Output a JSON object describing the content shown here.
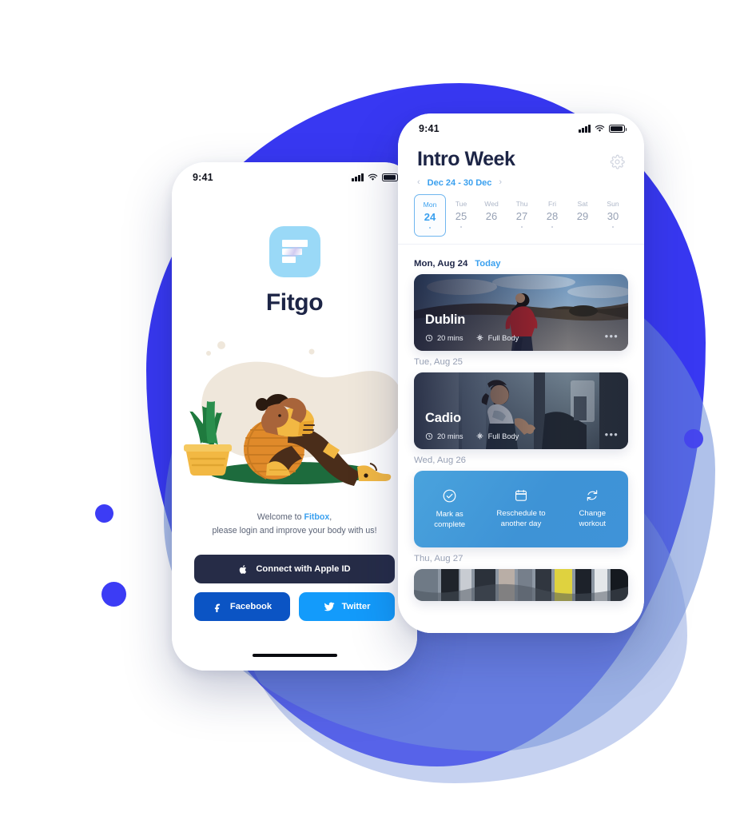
{
  "left_phone": {
    "status_bar": {
      "time": "9:41",
      "signal_icon": "cellular-signal-icon",
      "wifi_icon": "wifi-icon",
      "battery_icon": "battery-icon"
    },
    "logo": {
      "icon": "fitgo-logo-icon",
      "brand": "Fitgo"
    },
    "illustration": "woman-exercising-on-ball-illustration",
    "welcome": {
      "line1_pre": "Welcome to ",
      "line1_brand": "Fitbox",
      "line1_post": ",",
      "line2": "please login and improve your body with us!"
    },
    "buttons": {
      "apple": {
        "label": "Connect with Apple ID",
        "icon": "apple-icon",
        "color": "#262c47"
      },
      "facebook": {
        "label": "Facebook",
        "icon": "facebook-icon",
        "color": "#0b54c4"
      },
      "twitter": {
        "label": "Twitter",
        "icon": "twitter-icon",
        "color": "#139bfb"
      }
    },
    "home_indicator": "home-indicator"
  },
  "right_phone": {
    "status_bar": {
      "time": "9:41",
      "signal_icon": "cellular-signal-icon",
      "wifi_icon": "wifi-icon",
      "battery_icon": "battery-icon"
    },
    "title": "Intro Week",
    "settings_icon": "gear-icon",
    "week_nav": {
      "prev": "‹",
      "range": "Dec 24 - 30 Dec",
      "next": "›"
    },
    "days": [
      {
        "name": "Mon",
        "num": "24",
        "selected": true,
        "has_dot": true
      },
      {
        "name": "Tue",
        "num": "25",
        "selected": false,
        "has_dot": true
      },
      {
        "name": "Wed",
        "num": "26",
        "selected": false,
        "has_dot": false
      },
      {
        "name": "Thu",
        "num": "27",
        "selected": false,
        "has_dot": true
      },
      {
        "name": "Fri",
        "num": "28",
        "selected": false,
        "has_dot": true
      },
      {
        "name": "Sat",
        "num": "29",
        "selected": false,
        "has_dot": false
      },
      {
        "name": "Sun",
        "num": "30",
        "selected": false,
        "has_dot": true
      }
    ],
    "feed": [
      {
        "date_label": "Mon, Aug 24",
        "today_label": "Today",
        "is_today": true,
        "card": {
          "kind": "workout",
          "title": "Dublin",
          "duration": "20 mins",
          "focus": "Full Body",
          "duration_icon": "clock-icon",
          "focus_icon": "body-target-icon",
          "more_icon": "ellipsis-icon",
          "photo": "woman-running-on-road-photo"
        }
      },
      {
        "date_label": "Tue, Aug 25",
        "is_today": false,
        "card": {
          "kind": "workout",
          "title": "Cadio",
          "duration": "20 mins",
          "focus": "Full Body",
          "duration_icon": "clock-icon",
          "focus_icon": "body-target-icon",
          "more_icon": "ellipsis-icon",
          "photo": "woman-on-treadmill-photo"
        }
      },
      {
        "date_label": "Wed, Aug 26",
        "is_today": false,
        "card": {
          "kind": "actions",
          "accent": "#3f93d8",
          "items": [
            {
              "icon": "check-circle-icon",
              "label": "Mark as\ncomplete",
              "l1": "Mark as",
              "l2": "complete"
            },
            {
              "icon": "calendar-icon",
              "label": "Reschedule to another day",
              "l1": "Reschedule to",
              "l2": "another day"
            },
            {
              "icon": "refresh-icon",
              "label": "Change workout",
              "l1": "Change",
              "l2": "workout"
            }
          ]
        }
      },
      {
        "date_label": "Thu, Aug 27",
        "is_today": false,
        "card": {
          "kind": "workout-partial",
          "photo": "gym-treadmills-photo"
        }
      }
    ]
  },
  "background": {
    "blob_primary_color": "#3838f2",
    "blob_soft_color": "#6e8ed8",
    "dots": [
      "decor-dot-small",
      "decor-dot-medium",
      "decor-dot-right"
    ]
  }
}
